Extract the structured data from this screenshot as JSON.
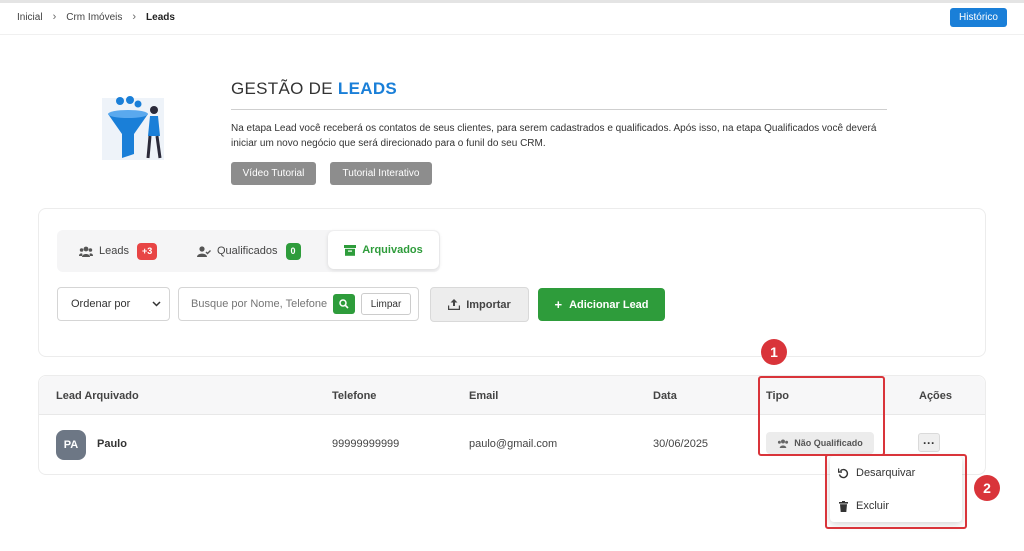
{
  "breadcrumb": {
    "home": "Inicial",
    "module": "Crm Imóveis",
    "current": "Leads"
  },
  "header": {
    "historico_label": "Histórico"
  },
  "intro": {
    "title_prefix": "GESTÃO DE",
    "title_accent": "LEADS",
    "description": "Na etapa Lead você receberá os contatos de seus clientes, para serem cadastrados e qualificados. Após isso, na etapa Qualificados você deverá iniciar um novo negócio que será direcionado para o funil do seu CRM.",
    "video_label": "Vídeo Tutorial",
    "tutorial_label": "Tutorial Interativo"
  },
  "tabs": {
    "leads": {
      "label": "Leads",
      "badge": "+3"
    },
    "qualificados": {
      "label": "Qualificados",
      "badge": "0"
    },
    "arquivados": {
      "label": "Arquivados"
    }
  },
  "toolbar": {
    "sort_label": "Ordenar por",
    "search_placeholder": "Busque por Nome, Telefone",
    "clear_label": "Limpar",
    "import_label": "Importar",
    "add_label": "Adicionar Lead"
  },
  "table": {
    "headers": {
      "lead": "Lead Arquivado",
      "telefone": "Telefone",
      "email": "Email",
      "data": "Data",
      "tipo": "Tipo",
      "acoes": "Ações"
    },
    "rows": [
      {
        "initials": "PA",
        "name": "Paulo",
        "telefone": "99999999999",
        "email": "paulo@gmail.com",
        "data": "30/06/2025",
        "tipo": "Não Qualificado"
      }
    ]
  },
  "dropdown": {
    "unarchive_label": "Desarquivar",
    "delete_label": "Excluir"
  },
  "annotations": {
    "marker_1": "1",
    "marker_2": "2"
  },
  "colors": {
    "primary_blue": "#1a7fd8",
    "success_green": "#2e9c3b",
    "danger_red": "#e84545",
    "annotation_red": "#d9343a"
  }
}
